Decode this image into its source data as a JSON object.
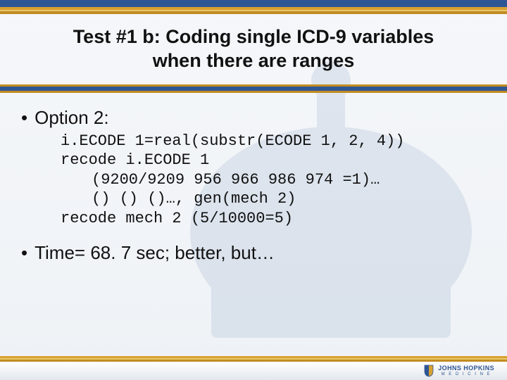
{
  "title_line1": "Test #1 b: Coding single ICD-9 variables",
  "title_line2": "when there are ranges",
  "bullet_option": "Option 2:",
  "code": {
    "l1": "i.ECODE 1=real(substr(ECODE 1, 2, 4))",
    "l2": "recode i.ECODE 1",
    "l3": "(9200/9209 956 966 986 974 =1)…",
    "l4": "() () ()…, gen(mech 2)",
    "l5": "recode mech 2 (5/10000=5)"
  },
  "bullet_time": "Time= 68. 7 sec; better, but…",
  "logo": {
    "name": "JOHNS HOPKINS",
    "sub": "M E D I C I N E"
  },
  "colors": {
    "blue": "#2f5694",
    "gold": "#c28c22"
  }
}
